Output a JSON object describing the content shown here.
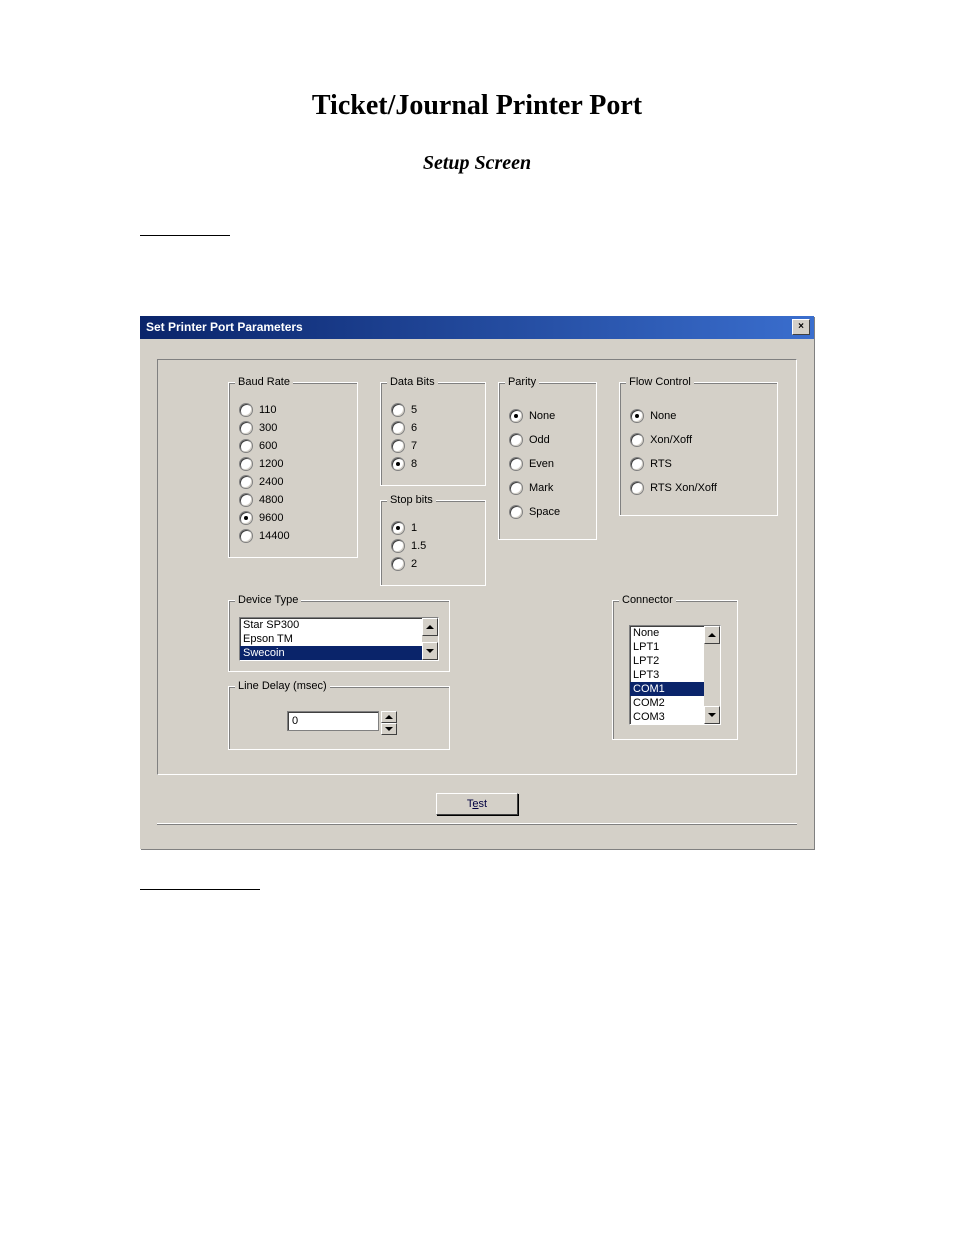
{
  "doc": {
    "title": "Ticket/Journal Printer Port",
    "subtitle": "Setup Screen"
  },
  "window": {
    "title": "Set Printer Port Parameters",
    "close_icon": "×"
  },
  "baud": {
    "legend": "Baud Rate",
    "options": [
      "110",
      "300",
      "600",
      "1200",
      "2400",
      "4800",
      "9600",
      "14400"
    ],
    "selected": "9600"
  },
  "databits": {
    "legend": "Data Bits",
    "options": [
      "5",
      "6",
      "7",
      "8"
    ],
    "selected": "8"
  },
  "stopbits": {
    "legend": "Stop bits",
    "options": [
      "1",
      "1.5",
      "2"
    ],
    "selected": "1"
  },
  "parity": {
    "legend": "Parity",
    "options": [
      "None",
      "Odd",
      "Even",
      "Mark",
      "Space"
    ],
    "selected": "None"
  },
  "flow": {
    "legend": "Flow Control",
    "options": [
      "None",
      "Xon/Xoff",
      "RTS",
      "RTS Xon/Xoff"
    ],
    "selected": "None"
  },
  "device": {
    "legend": "Device Type",
    "items": [
      "Star SP300",
      "Epson TM",
      "Swecoin"
    ],
    "selected": "Swecoin"
  },
  "linedelay": {
    "legend": "Line Delay (msec)",
    "value": "0"
  },
  "connector": {
    "legend": "Connector",
    "items": [
      "None",
      "LPT1",
      "LPT2",
      "LPT3",
      "COM1",
      "COM2",
      "COM3"
    ],
    "selected": "COM1"
  },
  "test_button": {
    "label_pre": "T",
    "label_accel": "e",
    "label_post": "st"
  }
}
